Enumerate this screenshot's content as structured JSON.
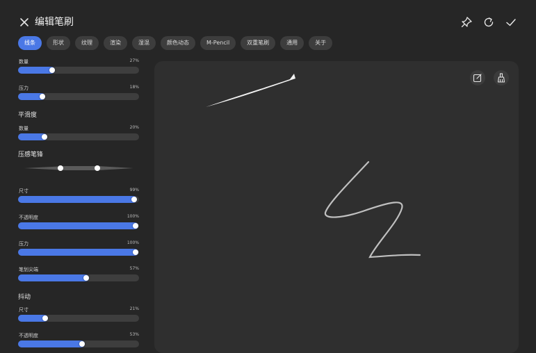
{
  "header": {
    "title": "编辑笔刷"
  },
  "tabs": [
    "线条",
    "形状",
    "纹理",
    "渲染",
    "湿混",
    "颜色动态",
    "M-Pencil",
    "双重笔刷",
    "通用",
    "关于"
  ],
  "active_tab": "线条",
  "sliders": [
    {
      "label": "数量",
      "value_text": "27%",
      "fraction": 0.27
    },
    {
      "label": "压力",
      "value_text": "18%",
      "fraction": 0.18
    },
    {
      "label": "数量",
      "value_text": "20%",
      "fraction": 0.2
    },
    {
      "label": "尺寸",
      "value_text": "99%",
      "fraction": 0.99
    },
    {
      "label": "不透明度",
      "value_text": "100%",
      "fraction": 1.0
    },
    {
      "label": "压力",
      "value_text": "100%",
      "fraction": 1.0
    },
    {
      "label": "笔划尖端",
      "value_text": "57%",
      "fraction": 0.57
    },
    {
      "label": "尺寸",
      "value_text": "21%",
      "fraction": 0.21
    },
    {
      "label": "不透明度",
      "value_text": "53%",
      "fraction": 0.53
    }
  ],
  "sections": {
    "smoothing": "平滑度",
    "pressure_taper": "压感笔锋",
    "jitter": "抖动"
  },
  "colors": {
    "accent": "#4a78e6",
    "background": "#262626",
    "canvas": "#2f2f2f"
  },
  "icons": {
    "close": "close-icon",
    "pin": "pin-icon",
    "reset": "reset-icon",
    "confirm": "check-icon",
    "edit": "edit-icon",
    "clear": "broom-icon"
  }
}
